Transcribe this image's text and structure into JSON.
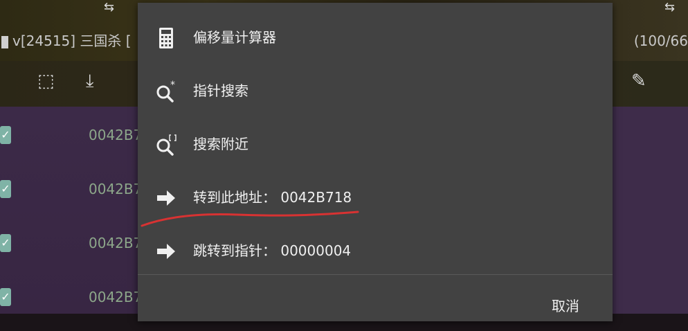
{
  "background": {
    "title_text": "v[24515] 三国杀 [",
    "count_text": "(100/66",
    "addresses": [
      "0042B7",
      "0042B7",
      "0042B7",
      "0042B7"
    ]
  },
  "menu": {
    "items": [
      {
        "label": "偏移量计算器",
        "icon": "calculator-icon"
      },
      {
        "label": "指针搜索",
        "icon": "pointer-search-icon"
      },
      {
        "label": "搜索附近",
        "icon": "search-nearby-icon"
      },
      {
        "label": "转到此地址：  0042B718",
        "icon": "arrow-right-icon"
      },
      {
        "label": "跳转到指针：  00000004",
        "icon": "arrow-right-icon"
      }
    ],
    "cancel_label": "取消"
  },
  "colors": {
    "menu_bg": "#424242",
    "text": "#f0f0f0",
    "annotation": "#d83232"
  }
}
